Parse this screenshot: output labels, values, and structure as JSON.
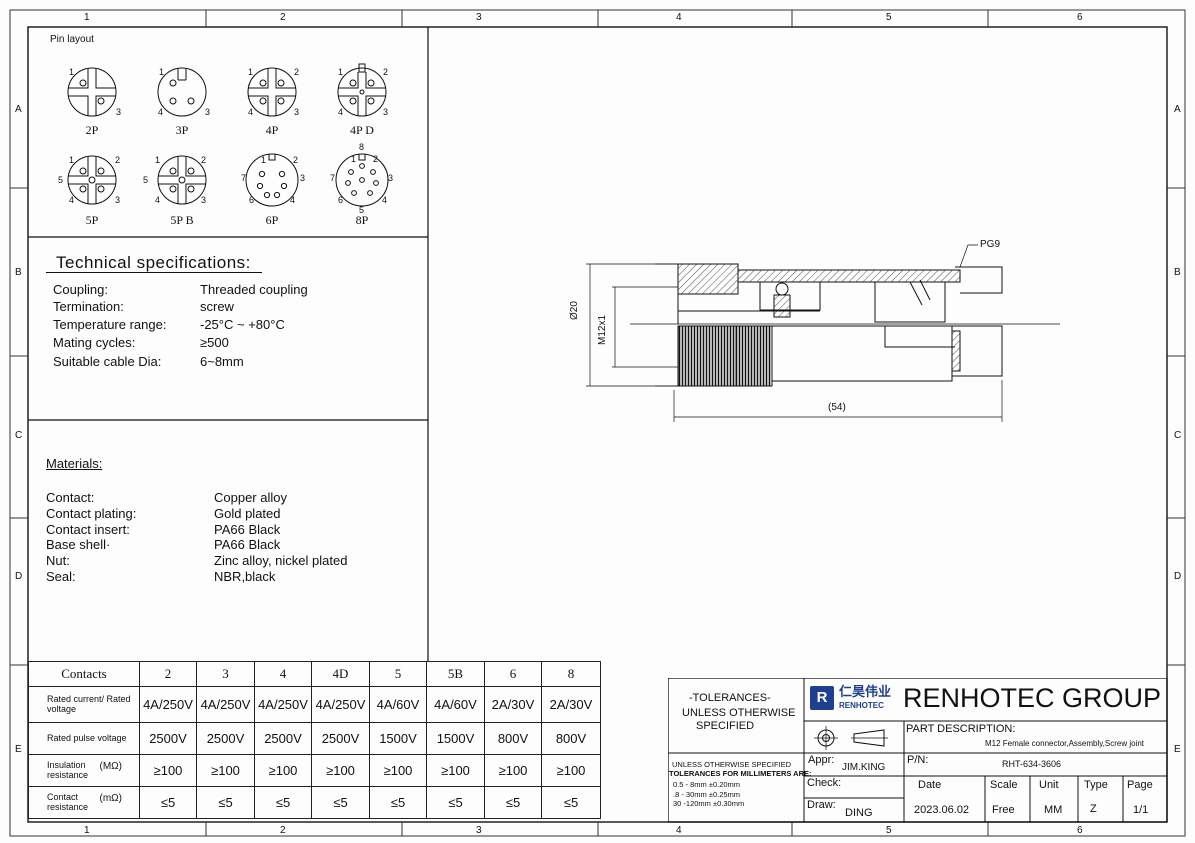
{
  "frame": {
    "col_labels": [
      "1",
      "2",
      "3",
      "4",
      "5",
      "6"
    ],
    "row_labels": [
      "A",
      "B",
      "C",
      "D",
      "E"
    ]
  },
  "pin_layout": {
    "title": "Pin layout",
    "items": [
      {
        "label": "2P",
        "pins": [
          "1",
          "3"
        ]
      },
      {
        "label": "3P",
        "pins": [
          "1",
          "4",
          "3"
        ]
      },
      {
        "label": "4P",
        "pins": [
          "1",
          "2",
          "4",
          "3"
        ]
      },
      {
        "label": "4P D",
        "pins": [
          "1",
          "2",
          "4",
          "3"
        ]
      },
      {
        "label": "5P",
        "pins": [
          "1",
          "2",
          "5",
          "4",
          "3"
        ]
      },
      {
        "label": "5P B",
        "pins": [
          "1",
          "2",
          "5",
          "4",
          "3"
        ]
      },
      {
        "label": "6P",
        "pins": [
          "1",
          "7",
          "2",
          "6",
          "3",
          "4"
        ]
      },
      {
        "label": "8P",
        "pins": [
          "8",
          "1",
          "2",
          "7",
          "3",
          "6",
          "4",
          "5"
        ]
      }
    ]
  },
  "tech_specs": {
    "title": "Technical specifications:",
    "rows": [
      {
        "key": "Coupling:",
        "value": "Threaded coupling"
      },
      {
        "key": "Termination:",
        "value": "screw"
      },
      {
        "key": "Temperature range:",
        "value": "-25°C ~ +80°C"
      },
      {
        "key": "Mating cycles:",
        "value": "≥500"
      },
      {
        "key": "Suitable cable Dia:",
        "value": "6~8mm"
      }
    ]
  },
  "materials": {
    "title": "Materials:",
    "rows": [
      {
        "key": "Contact:",
        "value": "Copper alloy"
      },
      {
        "key": "Contact plating:",
        "value": "Gold plated"
      },
      {
        "key": "Contact insert:",
        "value": "PA66 Black"
      },
      {
        "key": "Base shell·",
        "value": "PA66 Black"
      },
      {
        "key": "Nut:",
        "value": "Zinc alloy, nickel plated"
      },
      {
        "key": "Seal:",
        "value": "NBR,black"
      }
    ]
  },
  "drawing": {
    "pg_label": "PG9",
    "dia_label": "Ø20",
    "thread_label": "M12x1",
    "length_label": "(54)"
  },
  "contacts_table": {
    "caption": "Contacts",
    "columns": [
      "2",
      "3",
      "4",
      "4D",
      "5",
      "5B",
      "6",
      "8"
    ],
    "rows": [
      {
        "label": "Rated current/ Rated voltage",
        "values": [
          "4A/250V",
          "4A/250V",
          "4A/250V",
          "4A/250V",
          "4A/60V",
          "4A/60V",
          "2A/30V",
          "2A/30V"
        ]
      },
      {
        "label": "Rated pulse voltage",
        "values": [
          "2500V",
          "2500V",
          "2500V",
          "2500V",
          "1500V",
          "1500V",
          "800V",
          "800V"
        ]
      },
      {
        "label": "Insulation resistance",
        "unit": "(MΩ)",
        "values": [
          "≥100",
          "≥100",
          "≥100",
          "≥100",
          "≥100",
          "≥100",
          "≥100",
          "≥100"
        ]
      },
      {
        "label": "Contact resistance",
        "unit": "(mΩ)",
        "values": [
          "≤5",
          "≤5",
          "≤5",
          "≤5",
          "≤5",
          "≤5",
          "≤5",
          "≤5"
        ]
      }
    ]
  },
  "title_block": {
    "tolerances_title": "-TOLERANCES-",
    "tolerances_sub1": "UNLESS OTHERWISE",
    "tolerances_sub2": "SPECIFIED",
    "tol_note_1": "UNLESS OTHERWISE SPECIFIED",
    "tol_note_2": "TOLERANCES FOR MILLIMETERS ARE:",
    "tol_line_1": "0.5 - 8mm ±0.20mm",
    "tol_line_2": ".8 - 30mm ±0.25mm",
    "tol_line_3": "30 -120mm ±0.30mm",
    "logo_cn": "仁昊伟业",
    "logo_en": "RENHOTEC",
    "company": "RENHOTEC GROUP",
    "part_desc_label": "PART DESCRIPTION:",
    "part_desc_value": "M12 Female connector,Assembly,Screw joint",
    "appr_label": "Appr:",
    "appr_value": "JIM.KING",
    "pn_label": "P/N:",
    "pn_value": "RHT-634-3606",
    "check_label": "Check:",
    "draw_label": "Draw:",
    "draw_value": "DING",
    "date_label": "Date",
    "date_value": "2023.06.02",
    "scale_label": "Scale",
    "scale_value": "Free",
    "unit_label": "Unit",
    "unit_value": "MM",
    "type_label": "Type",
    "type_value": "Z",
    "page_label": "Page",
    "page_value": "1/1"
  }
}
